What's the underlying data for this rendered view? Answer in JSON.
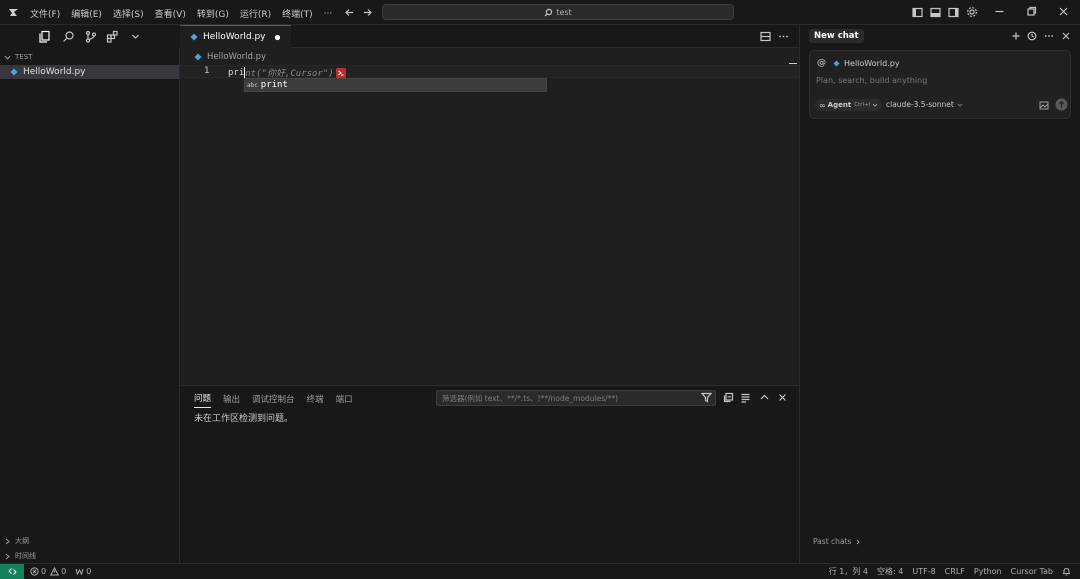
{
  "menu": [
    "文件(F)",
    "编辑(E)",
    "选择(S)",
    "查看(V)",
    "转到(G)",
    "运行(R)",
    "终端(T)",
    "···"
  ],
  "search": {
    "text": "test"
  },
  "explorer": {
    "section": "TEST",
    "files": [
      "HelloWorld.py"
    ],
    "bottom_sections": [
      "大纲",
      "时间线"
    ]
  },
  "editor": {
    "tab_label": "HelloWorld.py",
    "breadcrumb": "HelloWorld.py",
    "line_number": "1",
    "code_typed": "pri",
    "code_ghost": "nt(\"你好,Cursor\")",
    "suggest_badge": "abc",
    "suggest_item": "print"
  },
  "panel": {
    "tabs": [
      "问题",
      "输出",
      "调试控制台",
      "终端",
      "端口"
    ],
    "filter_placeholder": "筛选器(例如 text、**/*.ts、!**/node_modules/**)",
    "message": "未在工作区检测到问题。"
  },
  "chat": {
    "title": "New chat",
    "context_file": "HelloWorld.py",
    "placeholder": "Plan, search, build anything",
    "agent_label": "Agent",
    "agent_shortcut": "Ctrl+I",
    "model": "claude-3.5-sonnet",
    "past_chats": "Past chats"
  },
  "status": {
    "errors": "0",
    "warnings": "0",
    "ports": "0",
    "position": "行 1，列 4",
    "spaces": "空格: 4",
    "encoding": "UTF-8",
    "eol": "CRLF",
    "language": "Python",
    "cursor_tab": "Cursor Tab"
  },
  "colors": {
    "accent": "#0078d4",
    "python_icon": "#4ea3d8",
    "status_remote": "#16825d"
  }
}
